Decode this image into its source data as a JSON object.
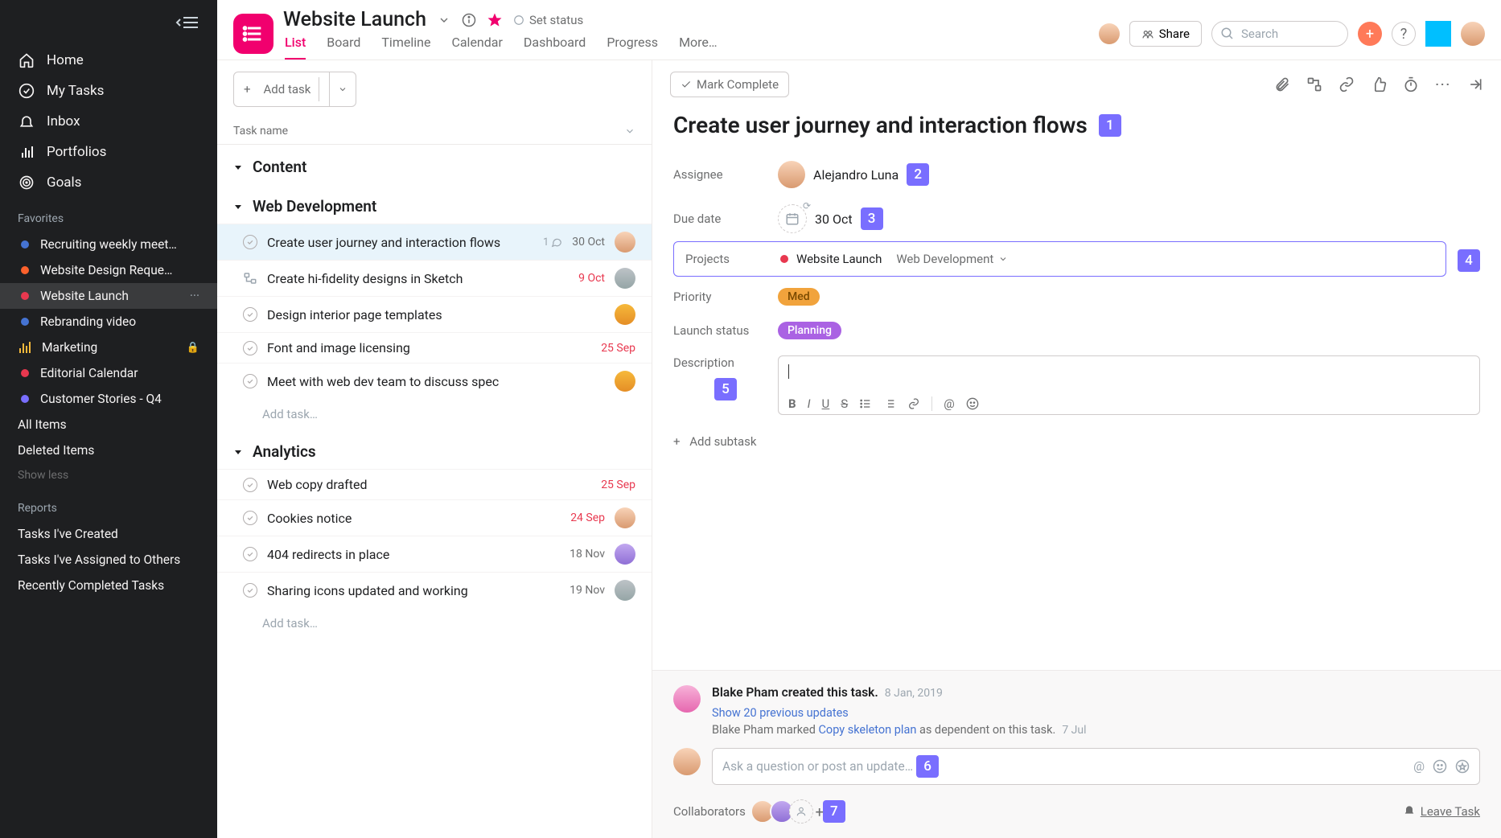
{
  "sidebar": {
    "nav": [
      {
        "label": "Home",
        "icon": "home"
      },
      {
        "label": "My Tasks",
        "icon": "check"
      },
      {
        "label": "Inbox",
        "icon": "bell"
      },
      {
        "label": "Portfolios",
        "icon": "bars"
      },
      {
        "label": "Goals",
        "icon": "target"
      }
    ],
    "favorites_label": "Favorites",
    "favorites": [
      {
        "label": "Recruiting weekly meet…",
        "color": "#4573d2"
      },
      {
        "label": "Website Design Reque…",
        "color": "#fd612c"
      },
      {
        "label": "Website Launch",
        "color": "#e8384f",
        "active": true
      },
      {
        "label": "Rebranding video",
        "color": "#4573d2"
      },
      {
        "label": "Marketing",
        "icon": "bars",
        "lock": true
      },
      {
        "label": "Editorial Calendar",
        "color": "#e8384f"
      },
      {
        "label": "Customer Stories - Q4",
        "color": "#796eff"
      }
    ],
    "all_items": "All Items",
    "deleted_items": "Deleted Items",
    "show_less": "Show less",
    "reports_label": "Reports",
    "reports": [
      "Tasks I've Created",
      "Tasks I've Assigned to Others",
      "Recently Completed Tasks"
    ]
  },
  "header": {
    "project": "Website Launch",
    "set_status": "Set status",
    "tabs": [
      "List",
      "Board",
      "Timeline",
      "Calendar",
      "Dashboard",
      "Progress",
      "More…"
    ],
    "share": "Share",
    "search": "Search"
  },
  "list": {
    "add_task": "Add task",
    "col_name": "Task name",
    "add_task_inline": "Add task…",
    "sections": [
      {
        "name": "Content",
        "tasks": []
      },
      {
        "name": "Web Development",
        "tasks": [
          {
            "name": "Create user journey and interaction flows",
            "comments": "1",
            "due": "30 Oct",
            "avatar": "p1",
            "selected": true
          },
          {
            "name": "Create hi-fidelity designs in Sketch",
            "due": "9 Oct",
            "red": true,
            "avatar": "p4",
            "subtask": true
          },
          {
            "name": "Design interior page templates",
            "avatar": "p3"
          },
          {
            "name": "Font and image licensing",
            "due": "25 Sep",
            "red": true
          },
          {
            "name": "Meet with web dev team to discuss spec",
            "avatar": "p3"
          }
        ],
        "add": true
      },
      {
        "name": "Analytics",
        "tasks": [
          {
            "name": "Web copy drafted",
            "due": "25 Sep",
            "red": true
          },
          {
            "name": "Cookies notice",
            "due": "24 Sep",
            "red": true,
            "avatar": "p1"
          },
          {
            "name": "404 redirects in place",
            "due": "18 Nov",
            "avatar": "p2"
          },
          {
            "name": "Sharing icons updated and working",
            "due": "19 Nov",
            "avatar": "p4"
          }
        ],
        "add": true
      }
    ]
  },
  "detail": {
    "mark_complete": "Mark Complete",
    "title": "Create user journey and interaction flows",
    "badges": {
      "title": "1",
      "assignee": "2",
      "due": "3",
      "projects": "4",
      "description": "5",
      "comment": "6",
      "collab": "7"
    },
    "assignee_label": "Assignee",
    "assignee": "Alejandro Luna",
    "due_label": "Due date",
    "due": "30 Oct",
    "projects_label": "Projects",
    "project_name": "Website Launch",
    "project_section": "Web Development",
    "priority_label": "Priority",
    "priority": "Med",
    "launch_label": "Launch status",
    "launch": "Planning",
    "description_label": "Description",
    "add_subtask": "Add subtask",
    "activity": {
      "creator": "Blake Pham created this task.",
      "created_date": "8 Jan, 2019",
      "show_prev": "Show 20 previous updates",
      "marked_by": "Blake Pham",
      "marked_text": " marked ",
      "marked_link": "Copy skeleton plan",
      "marked_suffix": " as dependent on this task.",
      "marked_date": "7 Jul"
    },
    "comment_placeholder": "Ask a question or post an update…",
    "collaborators_label": "Collaborators",
    "leave": "Leave Task"
  }
}
